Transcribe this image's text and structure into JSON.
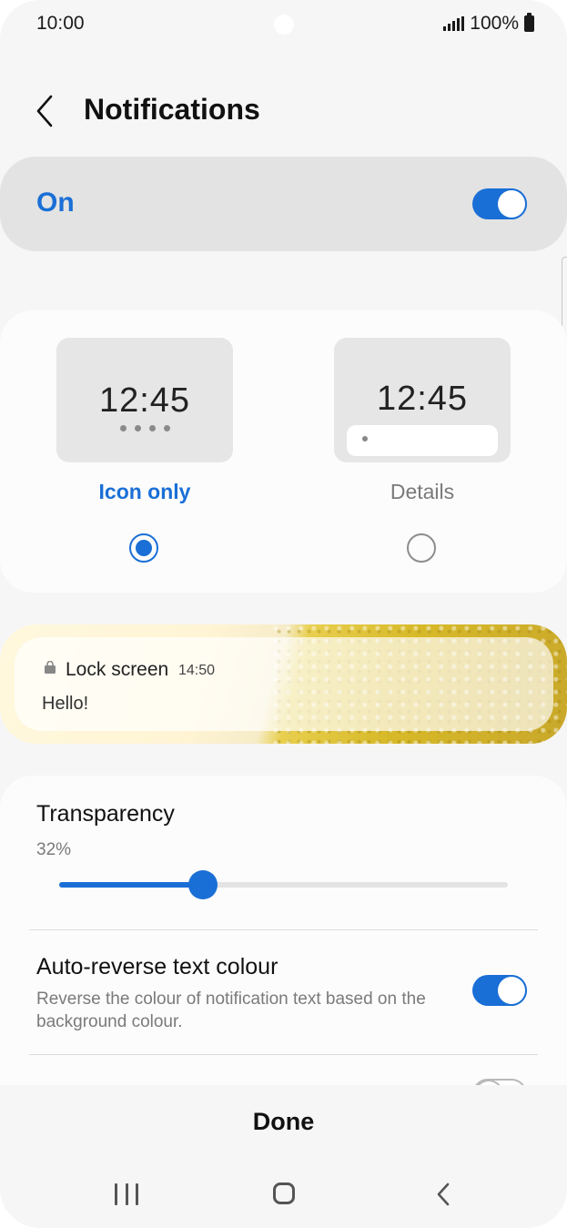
{
  "status_bar": {
    "time": "10:00",
    "battery": "100%"
  },
  "header": {
    "title": "Notifications"
  },
  "master_toggle": {
    "label": "On",
    "enabled": true
  },
  "style_options": {
    "icon_only": {
      "preview_time": "12:45",
      "label": "Icon only",
      "selected": true
    },
    "details": {
      "preview_time": "12:45",
      "label": "Details",
      "selected": false
    }
  },
  "lock_preview": {
    "app_name": "Lock screen",
    "time": "14:50",
    "message": "Hello!"
  },
  "settings": {
    "transparency": {
      "title": "Transparency",
      "value": "32%",
      "level": 32
    },
    "auto_reverse": {
      "title": "Auto-reverse text colour",
      "description": "Reverse the colour of notification text based on the background colour.",
      "enabled": true
    }
  },
  "footer": {
    "done_label": "Done"
  },
  "colors": {
    "accent": "#1a6fd6",
    "background": "#f6f6f6",
    "card": "#fcfcfc"
  }
}
